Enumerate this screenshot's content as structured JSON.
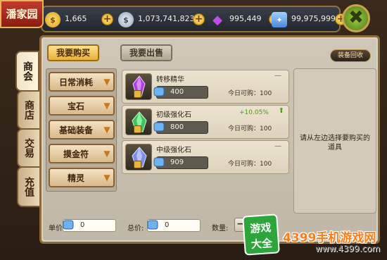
{
  "title": "潘家园",
  "resources": [
    {
      "name": "gold",
      "value": "1,665",
      "symbol": "$",
      "color": "#f2c12e"
    },
    {
      "name": "silver",
      "value": "1,073,741,823",
      "symbol": "$",
      "color": "#b8c6d4"
    },
    {
      "name": "gem",
      "value": "995,449",
      "symbol": "◆",
      "color": "#b63ad8"
    },
    {
      "name": "ticket",
      "value": "99,975,999",
      "symbol": "✦",
      "color": "#5ea8e8"
    }
  ],
  "close_glyph": "✖",
  "side_tabs": [
    "商会",
    "商店",
    "交易",
    "充值"
  ],
  "buttons": {
    "buy": "我要购买",
    "sell": "我要出售",
    "recycle": "装备回收"
  },
  "categories": [
    "日常消耗",
    "宝石",
    "基础装备",
    "摸金符",
    "精灵"
  ],
  "items": [
    {
      "name": "转移精华",
      "price": "400",
      "limit": "今日可购：100",
      "pct": "",
      "gem_color": "#b040e0"
    },
    {
      "name": "初级强化石",
      "price": "800",
      "limit": "今日可购：100",
      "pct": "+10.05%",
      "gem_color": "#3ec25a"
    },
    {
      "name": "中级强化石",
      "price": "909",
      "limit": "今日可购：100",
      "pct": "",
      "gem_color": "#7a8ef0"
    }
  ],
  "info_text": "请从左边选择要购买的道具",
  "bottom": {
    "unit_label": "单价:",
    "unit_value": "0",
    "total_label": "总价:",
    "total_value": "0",
    "qty_label": "数量:",
    "minus": "−"
  },
  "watermark": {
    "box1": "游戏",
    "box2": "大全",
    "site": "4399手机游戏网",
    "url": "www.4399.com"
  }
}
